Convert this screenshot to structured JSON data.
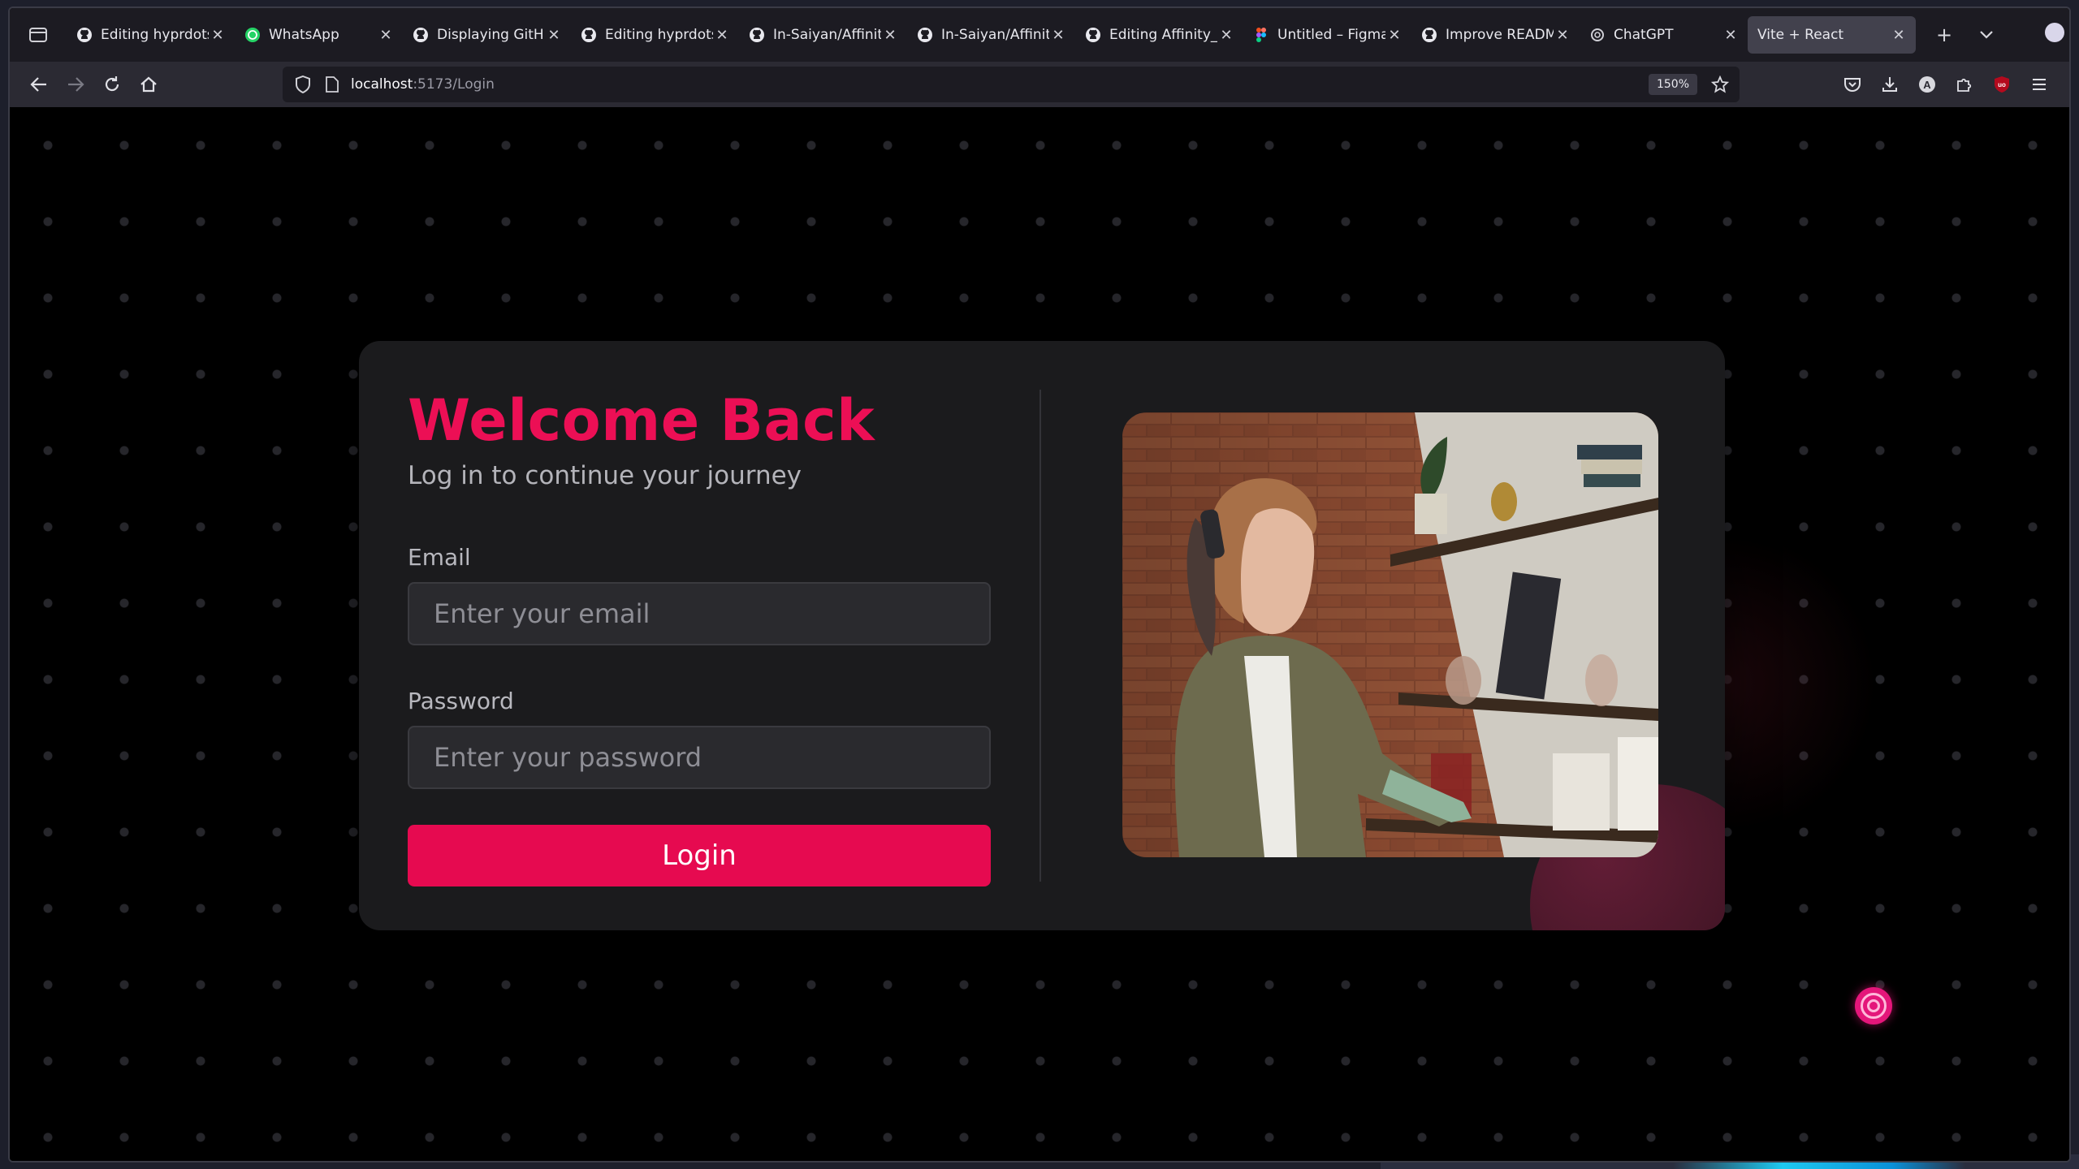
{
  "browser": {
    "tabs": [
      {
        "title": "Editing hyprdots/R",
        "icon": "github-icon",
        "active": false
      },
      {
        "title": "WhatsApp",
        "icon": "whatsapp-icon",
        "active": false
      },
      {
        "title": "Displaying GitHub",
        "icon": "github-icon",
        "active": false
      },
      {
        "title": "Editing hyprdots/R",
        "icon": "github-icon",
        "active": false
      },
      {
        "title": "In-Saiyan/Affinity_",
        "icon": "github-icon",
        "active": false
      },
      {
        "title": "In-Saiyan/Affinity_",
        "icon": "github-icon",
        "active": false
      },
      {
        "title": "Editing Affinity_fr",
        "icon": "github-icon",
        "active": false
      },
      {
        "title": "Untitled – Figma",
        "icon": "figma-icon",
        "active": false
      },
      {
        "title": "Improve README",
        "icon": "github-icon",
        "active": false
      },
      {
        "title": "ChatGPT",
        "icon": "chatgpt-icon",
        "active": false
      },
      {
        "title": "Vite + React",
        "icon": "",
        "active": true
      }
    ],
    "url": {
      "host": "localhost",
      "path": ":5173/Login"
    },
    "zoom": "150%"
  },
  "login": {
    "title": "Welcome Back",
    "subtitle": "Log in to continue your journey",
    "email_label": "Email",
    "email_placeholder": "Enter your email",
    "password_label": "Password",
    "password_placeholder": "Enter your password",
    "button_label": "Login"
  },
  "colors": {
    "accent": "#e60a50",
    "card_bg": "#1b1b1d",
    "page_bg": "#000000"
  }
}
